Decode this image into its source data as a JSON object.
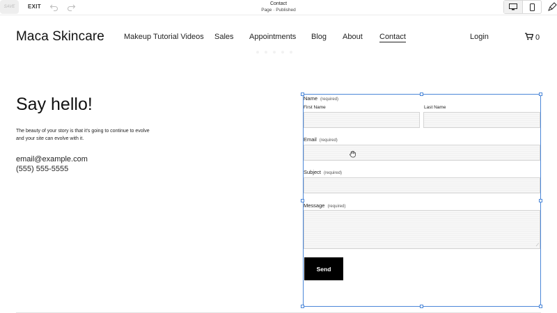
{
  "toolbar": {
    "save_label": "SAVE",
    "exit_label": "EXIT",
    "page_title": "Contact",
    "page_status": "Page · Published"
  },
  "site": {
    "brand": "Maca Skincare",
    "nav": [
      "Makeup Tutorial Videos",
      "Sales",
      "Appointments",
      "Blog",
      "About",
      "Contact"
    ],
    "active_nav": "Contact",
    "login": "Login",
    "cart_count": "0"
  },
  "content": {
    "heading": "Say hello!",
    "intro": "The beauty of your story is that it's going to continue to evolve and your site can evolve with it.",
    "email": "email@example.com",
    "phone": "(555) 555-5555"
  },
  "form": {
    "required_text": "(required)",
    "name_label": "Name",
    "first_name_label": "First Name",
    "last_name_label": "Last Name",
    "email_label": "Email",
    "subject_label": "Subject",
    "message_label": "Message",
    "send_label": "Send"
  },
  "colors": {
    "selection": "#4a86d8",
    "button": "#000000"
  }
}
